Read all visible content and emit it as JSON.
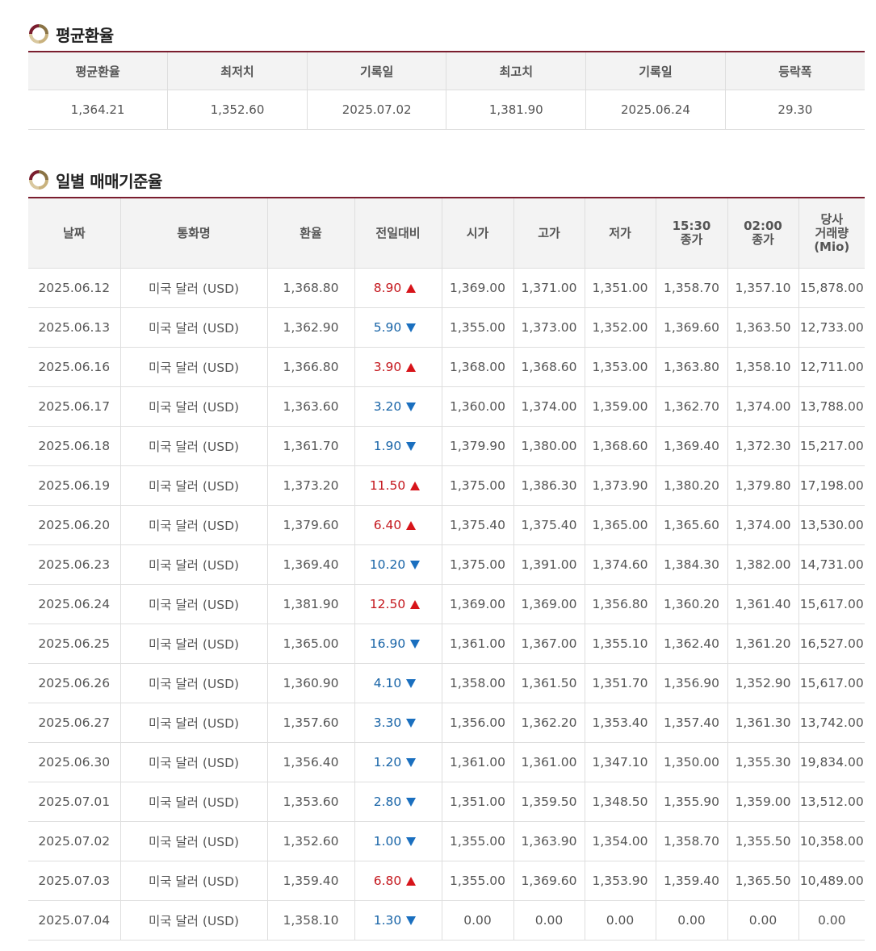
{
  "avg_section": {
    "title": "평균환율",
    "headers": [
      "평균환율",
      "최저치",
      "기록일",
      "최고치",
      "기록일",
      "등락폭"
    ],
    "values": [
      "1,364.21",
      "1,352.60",
      "2025.07.02",
      "1,381.90",
      "2025.06.24",
      "29.30"
    ]
  },
  "daily_section": {
    "title": "일별 매매기준율",
    "headers": [
      "날짜",
      "통화명",
      "환율",
      "전일대비",
      "시가",
      "고가",
      "저가",
      "15:30\n종가",
      "02:00\n종가",
      "당사\n거래량\n(Mio)"
    ],
    "rows": [
      {
        "date": "2025.06.12",
        "currency": "미국 달러 (USD)",
        "rate": "1,368.80",
        "change": "8.90",
        "dir": "up",
        "open": "1,369.00",
        "high": "1,371.00",
        "low": "1,351.00",
        "close1530": "1,358.70",
        "close0200": "1,357.10",
        "volume": "15,878.00"
      },
      {
        "date": "2025.06.13",
        "currency": "미국 달러 (USD)",
        "rate": "1,362.90",
        "change": "5.90",
        "dir": "down",
        "open": "1,355.00",
        "high": "1,373.00",
        "low": "1,352.00",
        "close1530": "1,369.60",
        "close0200": "1,363.50",
        "volume": "12,733.00"
      },
      {
        "date": "2025.06.16",
        "currency": "미국 달러 (USD)",
        "rate": "1,366.80",
        "change": "3.90",
        "dir": "up",
        "open": "1,368.00",
        "high": "1,368.60",
        "low": "1,353.00",
        "close1530": "1,363.80",
        "close0200": "1,358.10",
        "volume": "12,711.00"
      },
      {
        "date": "2025.06.17",
        "currency": "미국 달러 (USD)",
        "rate": "1,363.60",
        "change": "3.20",
        "dir": "down",
        "open": "1,360.00",
        "high": "1,374.00",
        "low": "1,359.00",
        "close1530": "1,362.70",
        "close0200": "1,374.00",
        "volume": "13,788.00"
      },
      {
        "date": "2025.06.18",
        "currency": "미국 달러 (USD)",
        "rate": "1,361.70",
        "change": "1.90",
        "dir": "down",
        "open": "1,379.90",
        "high": "1,380.00",
        "low": "1,368.60",
        "close1530": "1,369.40",
        "close0200": "1,372.30",
        "volume": "15,217.00"
      },
      {
        "date": "2025.06.19",
        "currency": "미국 달러 (USD)",
        "rate": "1,373.20",
        "change": "11.50",
        "dir": "up",
        "open": "1,375.00",
        "high": "1,386.30",
        "low": "1,373.90",
        "close1530": "1,380.20",
        "close0200": "1,379.80",
        "volume": "17,198.00"
      },
      {
        "date": "2025.06.20",
        "currency": "미국 달러 (USD)",
        "rate": "1,379.60",
        "change": "6.40",
        "dir": "up",
        "open": "1,375.40",
        "high": "1,375.40",
        "low": "1,365.00",
        "close1530": "1,365.60",
        "close0200": "1,374.00",
        "volume": "13,530.00"
      },
      {
        "date": "2025.06.23",
        "currency": "미국 달러 (USD)",
        "rate": "1,369.40",
        "change": "10.20",
        "dir": "down",
        "open": "1,375.00",
        "high": "1,391.00",
        "low": "1,374.60",
        "close1530": "1,384.30",
        "close0200": "1,382.00",
        "volume": "14,731.00"
      },
      {
        "date": "2025.06.24",
        "currency": "미국 달러 (USD)",
        "rate": "1,381.90",
        "change": "12.50",
        "dir": "up",
        "open": "1,369.00",
        "high": "1,369.00",
        "low": "1,356.80",
        "close1530": "1,360.20",
        "close0200": "1,361.40",
        "volume": "15,617.00"
      },
      {
        "date": "2025.06.25",
        "currency": "미국 달러 (USD)",
        "rate": "1,365.00",
        "change": "16.90",
        "dir": "down",
        "open": "1,361.00",
        "high": "1,367.00",
        "low": "1,355.10",
        "close1530": "1,362.40",
        "close0200": "1,361.20",
        "volume": "16,527.00"
      },
      {
        "date": "2025.06.26",
        "currency": "미국 달러 (USD)",
        "rate": "1,360.90",
        "change": "4.10",
        "dir": "down",
        "open": "1,358.00",
        "high": "1,361.50",
        "low": "1,351.70",
        "close1530": "1,356.90",
        "close0200": "1,352.90",
        "volume": "15,617.00"
      },
      {
        "date": "2025.06.27",
        "currency": "미국 달러 (USD)",
        "rate": "1,357.60",
        "change": "3.30",
        "dir": "down",
        "open": "1,356.00",
        "high": "1,362.20",
        "low": "1,353.40",
        "close1530": "1,357.40",
        "close0200": "1,361.30",
        "volume": "13,742.00"
      },
      {
        "date": "2025.06.30",
        "currency": "미국 달러 (USD)",
        "rate": "1,356.40",
        "change": "1.20",
        "dir": "down",
        "open": "1,361.00",
        "high": "1,361.00",
        "low": "1,347.10",
        "close1530": "1,350.00",
        "close0200": "1,355.30",
        "volume": "19,834.00"
      },
      {
        "date": "2025.07.01",
        "currency": "미국 달러 (USD)",
        "rate": "1,353.60",
        "change": "2.80",
        "dir": "down",
        "open": "1,351.00",
        "high": "1,359.50",
        "low": "1,348.50",
        "close1530": "1,355.90",
        "close0200": "1,359.00",
        "volume": "13,512.00"
      },
      {
        "date": "2025.07.02",
        "currency": "미국 달러 (USD)",
        "rate": "1,352.60",
        "change": "1.00",
        "dir": "down",
        "open": "1,355.00",
        "high": "1,363.90",
        "low": "1,354.00",
        "close1530": "1,358.70",
        "close0200": "1,355.50",
        "volume": "10,358.00"
      },
      {
        "date": "2025.07.03",
        "currency": "미국 달러 (USD)",
        "rate": "1,359.40",
        "change": "6.80",
        "dir": "up",
        "open": "1,355.00",
        "high": "1,369.60",
        "low": "1,353.90",
        "close1530": "1,359.40",
        "close0200": "1,365.50",
        "volume": "10,489.00"
      },
      {
        "date": "2025.07.04",
        "currency": "미국 달러 (USD)",
        "rate": "1,358.10",
        "change": "1.30",
        "dir": "down",
        "open": "0.00",
        "high": "0.00",
        "low": "0.00",
        "close1530": "0.00",
        "close0200": "0.00",
        "volume": "0.00"
      }
    ]
  },
  "colors": {
    "accent": "#7a1d2e",
    "up": "#c4171d",
    "down": "#1864a7",
    "header_bg": "#f3f3f3"
  },
  "icons": {
    "section_icon": "ring-bullet-icon",
    "up": "triangle-up-icon",
    "down": "triangle-down-icon"
  }
}
